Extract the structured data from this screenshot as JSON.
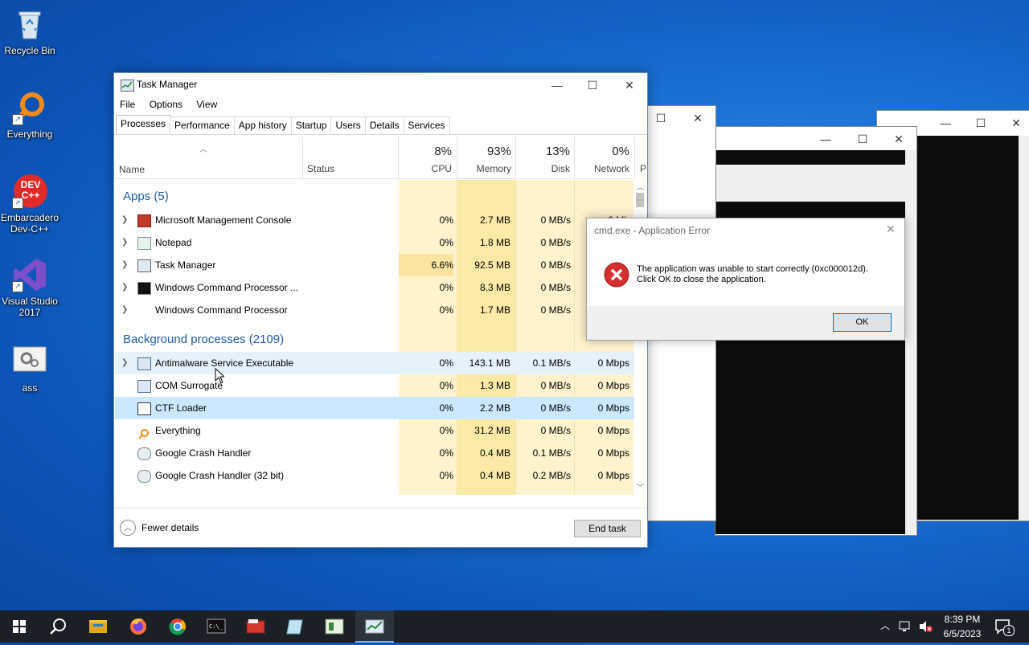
{
  "desktop": {
    "icons": [
      {
        "label": "Recycle Bin",
        "icon": "recycle-bin-icon"
      },
      {
        "label": "Everything",
        "icon": "everything-search-icon"
      },
      {
        "label": "Embarcadero Dev-C++",
        "icon": "devcpp-icon",
        "badge": "DEV C++"
      },
      {
        "label": "Visual Studio 2017",
        "icon": "visual-studio-icon"
      },
      {
        "label": "ass",
        "icon": "settings-file-icon"
      }
    ]
  },
  "task_manager": {
    "title": "Task Manager",
    "menu": [
      "File",
      "Options",
      "View"
    ],
    "tabs": [
      "Processes",
      "Performance",
      "App history",
      "Startup",
      "Users",
      "Details",
      "Services"
    ],
    "active_tab": "Processes",
    "columns": {
      "name": "Name",
      "status": "Status",
      "cpu": {
        "pct": "8%",
        "label": "CPU"
      },
      "memory": {
        "pct": "93%",
        "label": "Memory"
      },
      "disk": {
        "pct": "13%",
        "label": "Disk"
      },
      "network": {
        "pct": "0%",
        "label": "Network"
      },
      "power": "P"
    },
    "groups": {
      "apps": "Apps (5)",
      "background": "Background processes (2109)"
    },
    "apps": [
      {
        "name": "Microsoft Management Console",
        "cpu": "0%",
        "memory": "2.7 MB",
        "disk": "0 MB/s",
        "network": "0 Mb"
      },
      {
        "name": "Notepad",
        "cpu": "0%",
        "memory": "1.8 MB",
        "disk": "0 MB/s",
        "network": ""
      },
      {
        "name": "Task Manager",
        "cpu": "6.6%",
        "memory": "92.5 MB",
        "disk": "0 MB/s",
        "network": ""
      },
      {
        "name": "Windows Command Processor ...",
        "cpu": "0%",
        "memory": "8.3 MB",
        "disk": "0 MB/s",
        "network": ""
      },
      {
        "name": "Windows Command Processor",
        "cpu": "0%",
        "memory": "1.7 MB",
        "disk": "0 MB/s",
        "network": ""
      }
    ],
    "background": [
      {
        "name": "Antimalware Service Executable",
        "cpu": "0%",
        "memory": "143.1 MB",
        "disk": "0.1 MB/s",
        "network": "0 Mbps"
      },
      {
        "name": "COM Surrogate",
        "cpu": "0%",
        "memory": "1.3 MB",
        "disk": "0 MB/s",
        "network": "0 Mbps"
      },
      {
        "name": "CTF Loader",
        "cpu": "0%",
        "memory": "2.2 MB",
        "disk": "0 MB/s",
        "network": "0 Mbps"
      },
      {
        "name": "Everything",
        "cpu": "0%",
        "memory": "31.2 MB",
        "disk": "0 MB/s",
        "network": "0 Mbps"
      },
      {
        "name": "Google Crash Handler",
        "cpu": "0%",
        "memory": "0.4 MB",
        "disk": "0.1 MB/s",
        "network": "0 Mbps"
      },
      {
        "name": "Google Crash Handler (32 bit)",
        "cpu": "0%",
        "memory": "0.4 MB",
        "disk": "0.2 MB/s",
        "network": "0 Mbps"
      }
    ],
    "fewer_details": "Fewer details",
    "end_task": "End task"
  },
  "error_dialog": {
    "title": "cmd.exe - Application Error",
    "message_line1": "The application was unable to start correctly (0xc000012d).",
    "message_line2": "Click OK to close the application.",
    "ok_label": "OK"
  },
  "taskbar": {
    "items": [
      "start-icon",
      "search-icon",
      "file-explorer-icon",
      "firefox-icon",
      "chrome-icon",
      "command-prompt-icon",
      "management-console-icon",
      "notepad-icon",
      "paint-icon",
      "task-manager-icon"
    ],
    "time": "8:39 PM",
    "date": "6/5/2023",
    "notification_count": "1"
  },
  "colors": {
    "accent": "#1f5ea8",
    "cpu_highlight": "#fbe9a6",
    "error_red": "#d32f2f"
  }
}
